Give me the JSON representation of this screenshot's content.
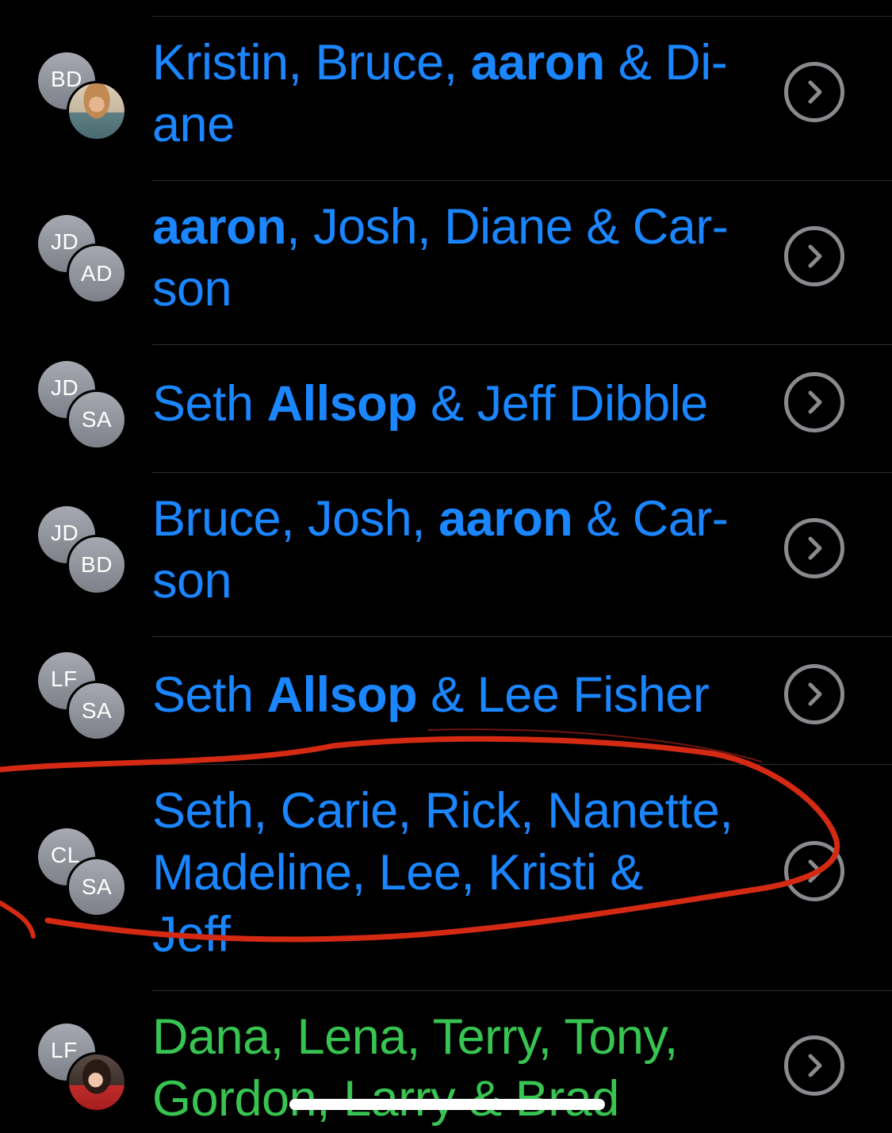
{
  "colors": {
    "background": "#000000",
    "link_blue": "#1a86ff",
    "imessage_green": "#37c451",
    "separator": "#2e2e30",
    "chevron": "#8a8a8f",
    "annotation_red": "#d42a14"
  },
  "conversations": [
    {
      "back_initials": "BD",
      "front_initials": "",
      "front_is_photo": true,
      "title_parts": [
        "Kristin, Bruce, ",
        "aaron",
        " & Di-\nane"
      ],
      "color": "blue",
      "detail_icon": "chevron-right-circle-icon"
    },
    {
      "back_initials": "JD",
      "front_initials": "AD",
      "front_is_photo": false,
      "title_parts": [
        "",
        "aaron",
        ", Josh, Diane & Car-\nson"
      ],
      "color": "blue",
      "detail_icon": "chevron-right-circle-icon"
    },
    {
      "back_initials": "JD",
      "front_initials": "SA",
      "front_is_photo": false,
      "title_parts": [
        "Seth ",
        "Allsop",
        " & Jeff Dibble"
      ],
      "color": "blue",
      "detail_icon": "chevron-right-circle-icon"
    },
    {
      "back_initials": "JD",
      "front_initials": "BD",
      "front_is_photo": false,
      "title_parts": [
        "Bruce, Josh, ",
        "aaron",
        " & Car-\nson"
      ],
      "color": "blue",
      "detail_icon": "chevron-right-circle-icon"
    },
    {
      "back_initials": "LF",
      "front_initials": "SA",
      "front_is_photo": false,
      "title_parts": [
        "Seth ",
        "Allsop",
        " & Lee Fisher"
      ],
      "color": "blue",
      "detail_icon": "chevron-right-circle-icon"
    },
    {
      "back_initials": "CL",
      "front_initials": "SA",
      "front_is_photo": false,
      "title_parts": [
        "Seth, Carie, Rick, Nanette,\nMadeline, Lee, Kristi &\nJeff",
        "",
        ""
      ],
      "color": "blue",
      "detail_icon": "chevron-right-circle-icon",
      "circled_annotation": true
    },
    {
      "back_initials": "LF",
      "front_initials": "",
      "front_is_photo": true,
      "title_parts": [
        "Dana, Lena, Terry, Tony,\nGordon, Larry & Brad",
        "",
        ""
      ],
      "color": "green",
      "detail_icon": "chevron-right-circle-icon"
    }
  ]
}
